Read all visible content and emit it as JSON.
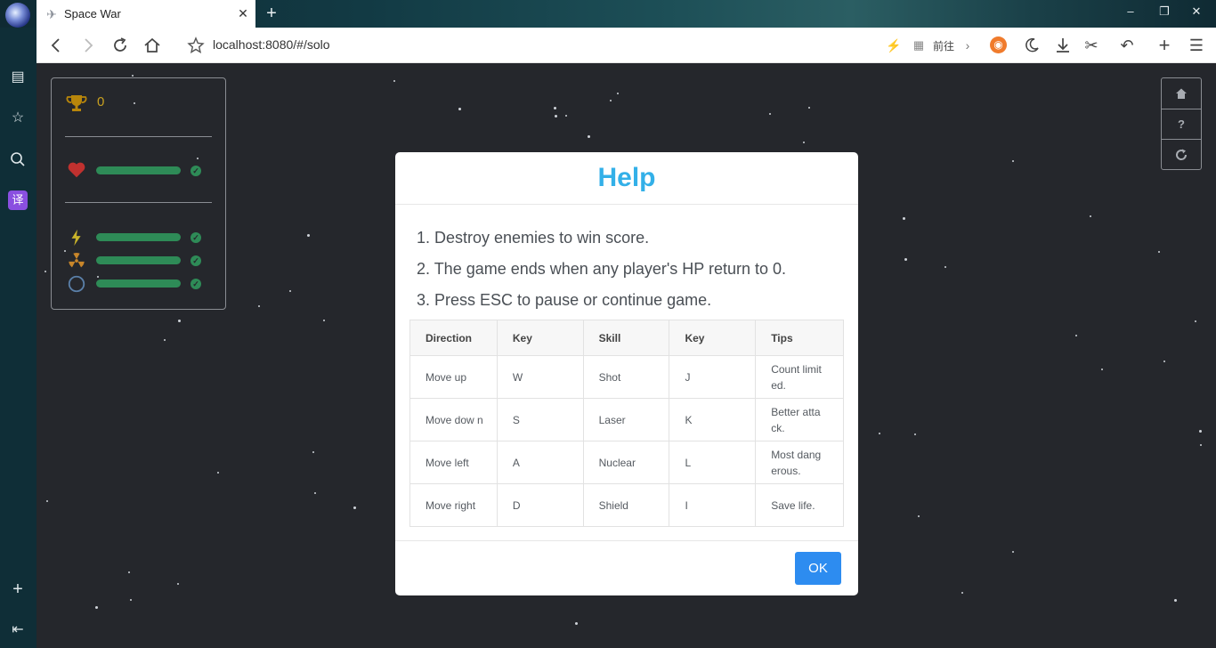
{
  "browser": {
    "tab_title": "Space War",
    "tab_favicon": "spaceship-icon",
    "new_tab_label": "+",
    "url": "localhost:8080/#/solo",
    "goto_label": "前往",
    "window_controls": {
      "minimize": "–",
      "restore": "❐",
      "close": "✕"
    }
  },
  "sidebar": {
    "translate_label": "译"
  },
  "game": {
    "score": "0",
    "health_level": 1.0,
    "skill_levels": [
      1.0,
      1.0,
      1.0
    ],
    "accent_colors": {
      "trophy": "#b8860b",
      "heart": "#c0312f",
      "bar": "#2e8b57",
      "lightning": "#c9b32a",
      "shield": "#5a7fa8"
    },
    "side_buttons": [
      "home-icon",
      "help-icon",
      "refresh-icon"
    ],
    "help_glyph": "?"
  },
  "modal": {
    "title": "Help",
    "rules": [
      "1. Destroy enemies to win score.",
      "2. The game ends when any player's HP return to 0.",
      "3. Press ESC to pause or continue game."
    ],
    "table": {
      "headers": [
        "Direction",
        "Key",
        "Skill",
        "Key",
        "Tips"
      ],
      "rows": [
        [
          "Move up",
          "W",
          "Shot",
          "J",
          "Count limit ed."
        ],
        [
          "Move dow n",
          "S",
          "Laser",
          "K",
          "Better atta ck."
        ],
        [
          "Move left",
          "A",
          "Nuclear",
          "L",
          "Most dang erous."
        ],
        [
          "Move right",
          "D",
          "Shield",
          "I",
          "Save life."
        ]
      ]
    },
    "ok_label": "OK",
    "title_color": "#33b0e8",
    "ok_color": "#2d8cf0"
  }
}
